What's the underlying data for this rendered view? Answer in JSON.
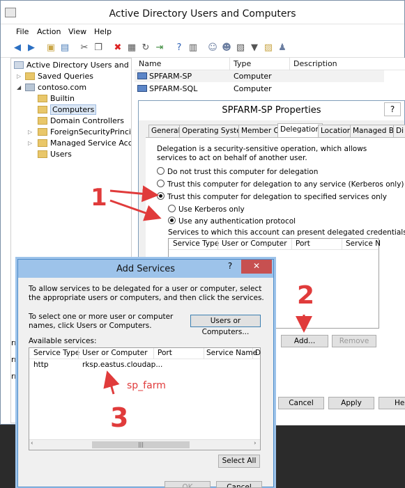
{
  "window": {
    "title": "Active Directory Users and Computers"
  },
  "menu": [
    "File",
    "Action",
    "View",
    "Help"
  ],
  "tree": {
    "root": "Active Directory Users and Com",
    "saved_queries": "Saved Queries",
    "domain": "contoso.com",
    "items": [
      "Builtin",
      "Computers",
      "Domain Controllers",
      "ForeignSecurityPrincipals",
      "Managed Service Accour",
      "Users"
    ]
  },
  "list": {
    "headers": [
      "Name",
      "Type",
      "Description"
    ],
    "rows": [
      {
        "name": "SPFARM-SP",
        "type": "Computer"
      },
      {
        "name": "SPFARM-SQL",
        "type": "Computer"
      }
    ]
  },
  "left_fragments": [
    "rning",
    "rning",
    "rning"
  ],
  "properties": {
    "title": "SPFARM-SP Properties",
    "title_help": "?",
    "title_close": "✕",
    "tabs": [
      "General",
      "Operating System",
      "Member Of",
      "Delegation",
      "Location",
      "Managed By",
      "Di"
    ],
    "active_tab": "Delegation",
    "description": "Delegation is a security-sensitive operation, which allows services to act on behalf of another user.",
    "options": [
      "Do not trust this computer for delegation",
      "Trust this computer for delegation to any service (Kerberos only)",
      "Trust this computer for delegation to specified services only"
    ],
    "sub_options": [
      "Use Kerberos only",
      "Use any authentication protocol"
    ],
    "services_label": "Services to which this account can present delegated credentials:",
    "services_headers": [
      "Service Type",
      "User or Computer",
      "Port",
      "Service N"
    ],
    "add_button": "Add...",
    "remove_button": "Remove",
    "cancel_button": "Cancel",
    "apply_button": "Apply",
    "help_button": "He"
  },
  "add_services": {
    "title": "Add Services",
    "help": "?",
    "close": "✕",
    "intro": "To allow services to be delegated for a user or computer, select the appropriate users or computers, and then click the services.",
    "select_text": "To select one or more user or computer names, click Users or Computers.",
    "users_button": "Users or Computers...",
    "available_label": "Available services:",
    "headers": [
      "Service Type",
      "User or Computer",
      "Port",
      "Service Name",
      "D"
    ],
    "rows": [
      {
        "service_type": "http",
        "user_or_computer": "rksp.eastus.cloudap..."
      }
    ],
    "select_all": "Select All",
    "ok": "OK",
    "cancel": "Cancel"
  },
  "annotations": {
    "one": "1",
    "two": "2",
    "three": "3",
    "sp_farm": "sp_farm"
  },
  "colors": {
    "annotation": "#e03b3b",
    "dialog_border": "#4f8dc9",
    "selection": "#dbe7f5"
  }
}
